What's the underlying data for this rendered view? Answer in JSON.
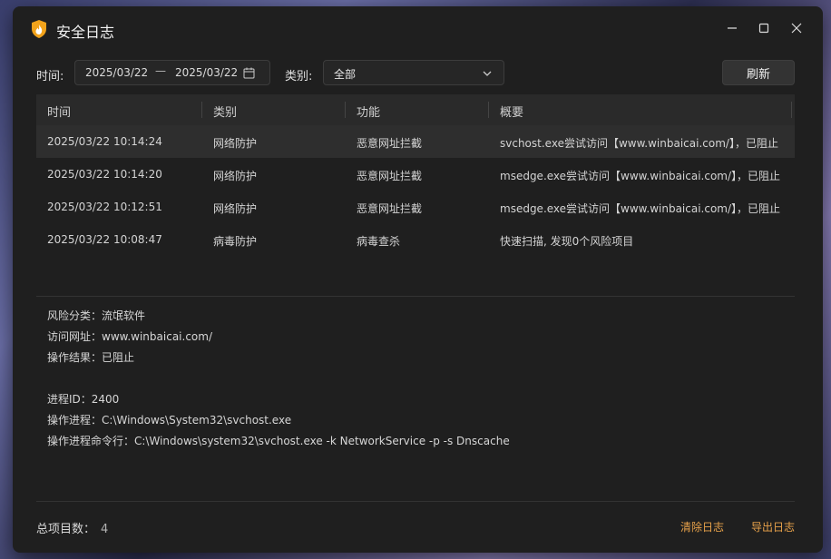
{
  "window": {
    "title": "安全日志"
  },
  "filters": {
    "time_label": "时间:",
    "date_start": "2025/03/22",
    "date_sep": "—",
    "date_end": "2025/03/22",
    "category_label": "类别:",
    "category_value": "全部",
    "refresh_label": "刷新"
  },
  "table": {
    "columns": [
      "时间",
      "类别",
      "功能",
      "概要"
    ],
    "rows": [
      {
        "time": "2025/03/22 10:14:24",
        "category": "网络防护",
        "function": "恶意网址拦截",
        "summary": "svchost.exe尝试访问【www.winbaicai.com/】，已阻止"
      },
      {
        "time": "2025/03/22 10:14:20",
        "category": "网络防护",
        "function": "恶意网址拦截",
        "summary": "msedge.exe尝试访问【www.winbaicai.com/】，已阻止"
      },
      {
        "time": "2025/03/22 10:12:51",
        "category": "网络防护",
        "function": "恶意网址拦截",
        "summary": "msedge.exe尝试访问【www.winbaicai.com/】，已阻止"
      },
      {
        "time": "2025/03/22 10:08:47",
        "category": "病毒防护",
        "function": "病毒查杀",
        "summary": "快速扫描, 发现0个风险项目"
      }
    ]
  },
  "details": {
    "risk_type": "风险分类：流氓软件",
    "url": "访问网址：www.winbaicai.com/",
    "result": "操作结果：已阻止",
    "pid": "进程ID：2400",
    "process": "操作进程：C:\\Windows\\System32\\svchost.exe",
    "cmdline": "操作进程命令行：C:\\Windows\\system32\\svchost.exe -k NetworkService -p -s Dnscache"
  },
  "footer": {
    "total_label": "总项目数：",
    "total_count": "4",
    "clear_label": "清除日志",
    "export_label": "导出日志"
  },
  "colors": {
    "accent": "#e8a24a",
    "background": "#1f1f1f",
    "selected_row": "#2e2e2e"
  }
}
